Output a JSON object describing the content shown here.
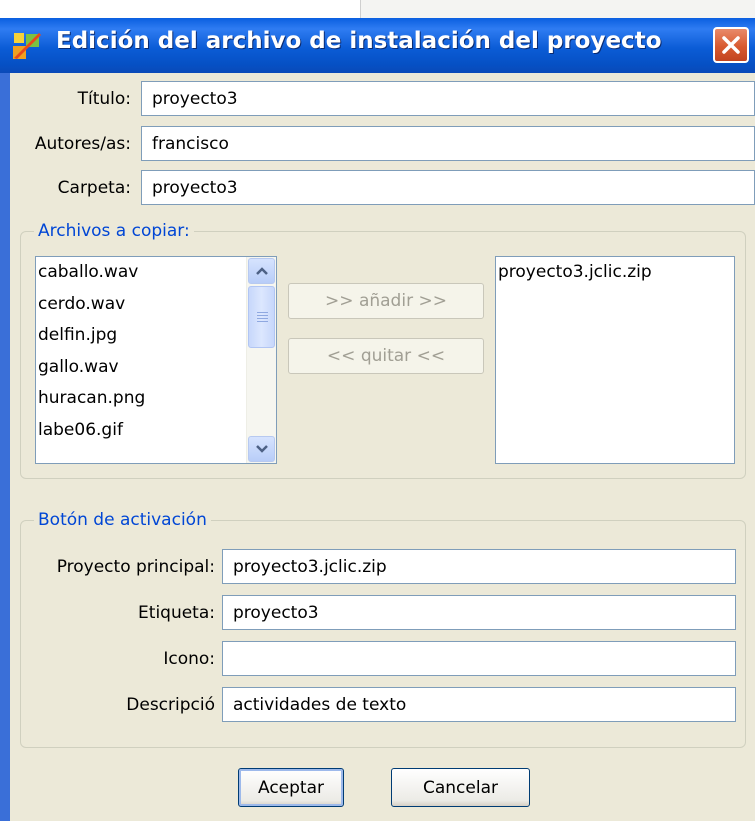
{
  "window": {
    "title": "Edición del archivo de instalación del proyecto"
  },
  "form": {
    "titulo_label": "Título:",
    "titulo_value": "proyecto3",
    "autores_label": "Autores/as:",
    "autores_value": "francisco",
    "carpeta_label": "Carpeta:",
    "carpeta_value": "proyecto3"
  },
  "files_group": {
    "legend": "Archivos a copiar:",
    "available_files": [
      "caballo.wav",
      "cerdo.wav",
      "delfin.jpg",
      "gallo.wav",
      "huracan.png",
      "labe06.gif"
    ],
    "add_button": ">> añadir >>",
    "remove_button": "<< quitar <<",
    "selected_files": [
      "proyecto3.jclic.zip"
    ]
  },
  "activation_group": {
    "legend": "Botón de activación",
    "proyecto_label": "Proyecto principal:",
    "proyecto_value": "proyecto3.jclic.zip",
    "etiqueta_label": "Etiqueta:",
    "etiqueta_value": "proyecto3",
    "icono_label": "Icono:",
    "icono_value": "",
    "descripcion_label": "Descripció",
    "descripcion_value": "actividades de texto"
  },
  "buttons": {
    "accept": "Aceptar",
    "cancel": "Cancelar"
  },
  "colors": {
    "titlebar": "#0a5fe0",
    "dialog_bg": "#ece9d8",
    "legend_text": "#0046d5",
    "input_border": "#7f9db9"
  }
}
